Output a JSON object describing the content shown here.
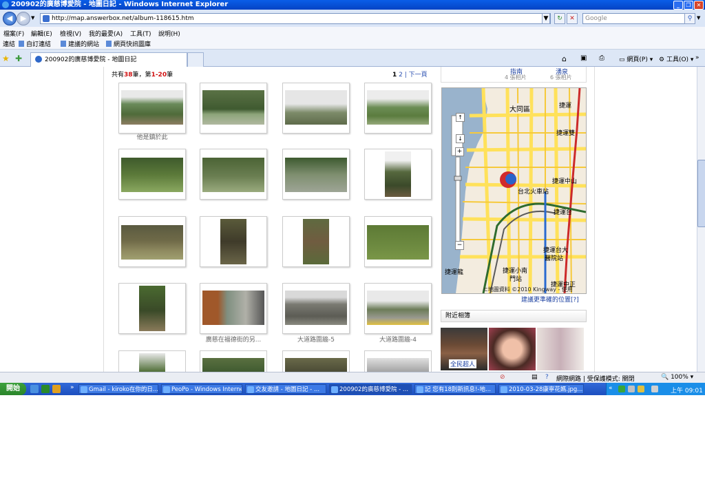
{
  "window": {
    "title": "200902的廣慈博愛院 - 地圖日記 - Windows Internet Explorer"
  },
  "address": {
    "url": "http://map.answerbox.net/album-118615.htm",
    "search_placeholder": "Google"
  },
  "menus": [
    "檔案(F)",
    "編輯(E)",
    "檢視(V)",
    "我的最愛(A)",
    "工具(T)",
    "說明(H)"
  ],
  "links_bar": {
    "label": "連結",
    "items": [
      "自訂連結",
      "建議的網站",
      "網頁快訊圖庫"
    ]
  },
  "tab": {
    "title": "200902的廣慈博愛院 - 地圖日記"
  },
  "toolbar": {
    "page": "網頁(P)",
    "tools": "工具(O)"
  },
  "album": {
    "count_prefix": "共有",
    "count": "38",
    "count_mid": "筆，第",
    "range": "1-20",
    "count_suffix": "筆",
    "pager": {
      "page1": "1",
      "page2": "2",
      "sep": "|",
      "next": "下一頁"
    },
    "captions": {
      "c0": "他是鎮於此",
      "c13": "廣慈在福德街的另...",
      "c14": "大道路圍牆-5",
      "c15": "大道路圍牆-4"
    }
  },
  "sidebar": {
    "top_labels": [
      "指南",
      "4 張相片",
      "湧泉",
      "6 張相片"
    ],
    "map_labels": [
      "大同區",
      "捷運",
      "捷運雙",
      "台北火車站",
      "捷運中山",
      "捷運台",
      "捷運台大",
      "醫院站",
      "捷運小南",
      "門站",
      "捷運中正",
      "捷運龍",
      "⊂地圖資料 ©2010 Kingway - 使用"
    ],
    "map_link": "建議更準確的位置[?]",
    "nearby_title": "附近相簿",
    "nearby_caption": "全民超人",
    "map_zoom_symbols": [
      "+",
      "−"
    ]
  },
  "status": {
    "security": "網際網路 | 受保護模式: 關閉",
    "zoom": "100%"
  },
  "taskbar": {
    "start": "開始",
    "tasks": [
      "Gmail - kiroko在你的日...",
      "PeoPo - Windows Internet...",
      "交友邀請 - 地圖日記 - ...",
      "200902的廣慈博愛院 - ...",
      "記 您有18則新訊息!-地...",
      "2010-03-28康寧花媽.jpg..."
    ],
    "clock": "上午 09:01"
  }
}
